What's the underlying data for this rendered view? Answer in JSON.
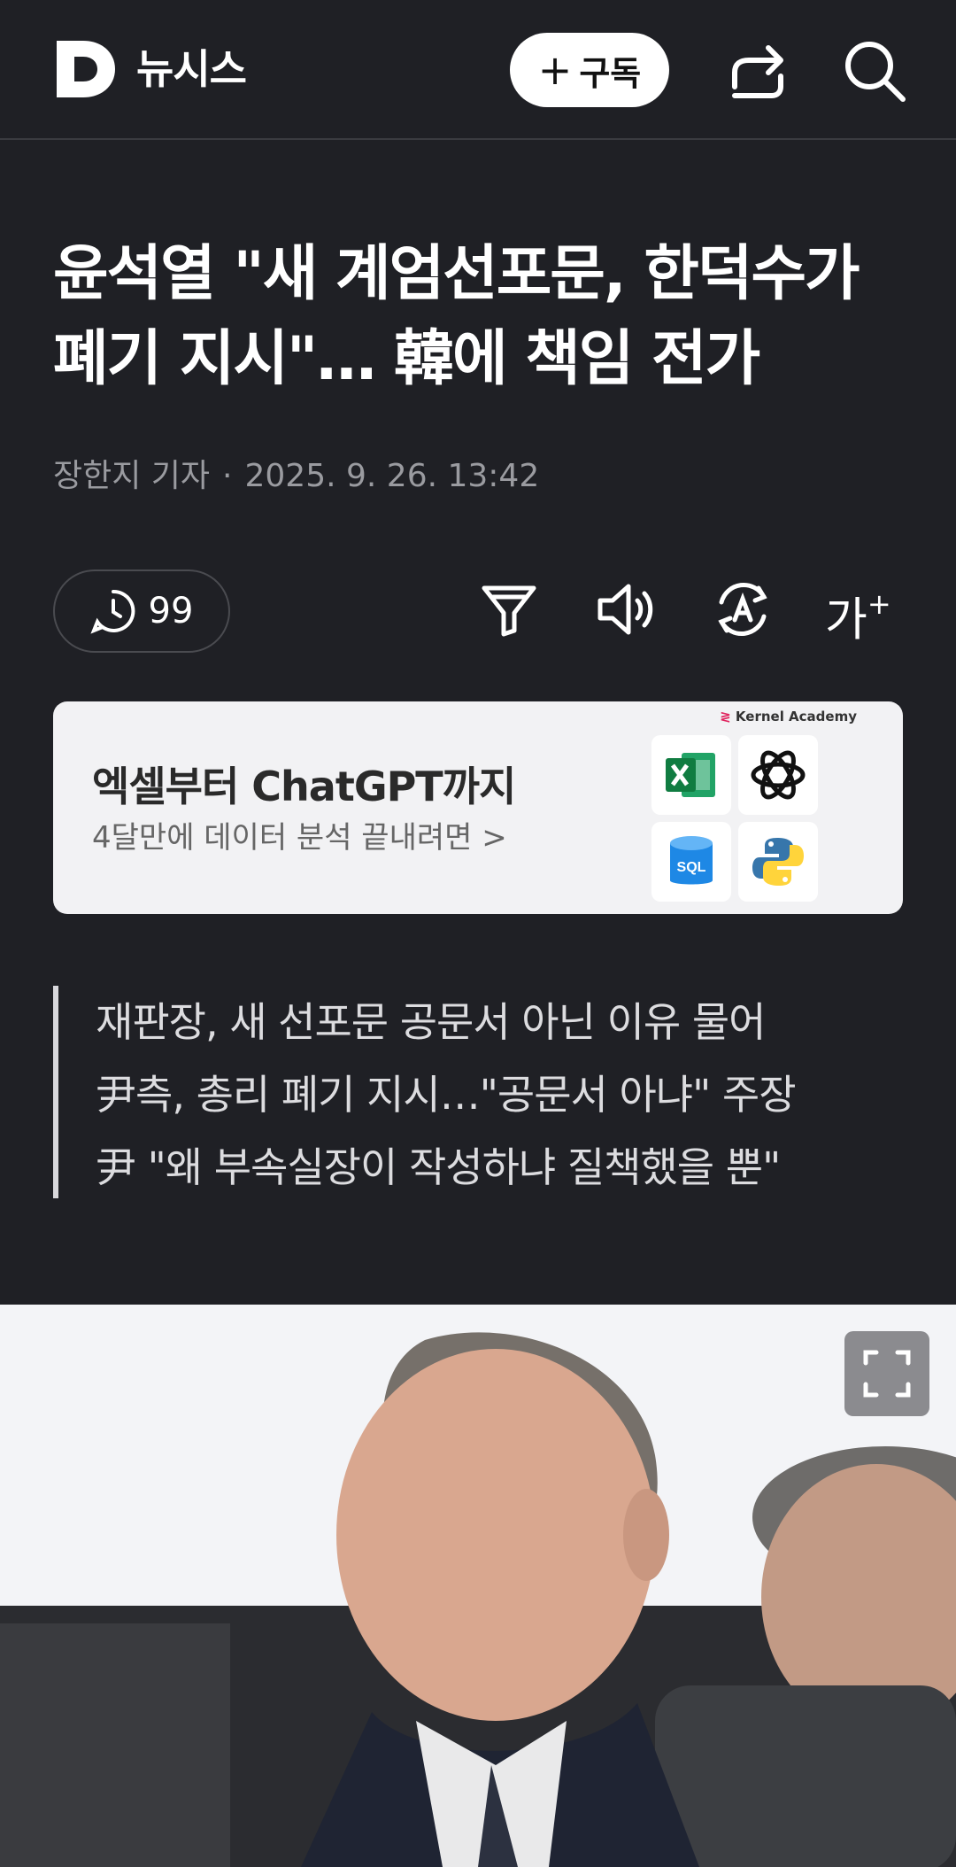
{
  "header": {
    "brand": "뉴시스",
    "subscribe_label": "구독",
    "subscribe_plus": "+"
  },
  "article": {
    "title": "윤석열 \"새 계엄선포문, 한덕수가 폐기 지시\"… 韓에 책임 전가",
    "author": "장한지 기자",
    "separator": "·",
    "date": "2025. 9. 26. 13:42"
  },
  "toolbar": {
    "comment_count": "99",
    "font_size_label": "가",
    "font_size_plus": "+"
  },
  "ad": {
    "brand": "Kernel Academy",
    "title": "엑셀부터 ChatGPT까지",
    "subtitle": "4달만에 데이터 분석 끝내려면 >",
    "tiles": [
      "excel-icon",
      "chatgpt-icon",
      "sql-icon",
      "python-icon"
    ]
  },
  "summary": {
    "lines": [
      "재판장, 새 선포문 공문서 아닌 이유 물어",
      "尹측, 총리 폐기 지시…\"공문서 아냐\" 주장",
      "尹 \"왜 부속실장이 작성하냐 질책했을 뿐\""
    ]
  },
  "colors": {
    "background": "#1f2025",
    "ad_background": "#f2f2f4",
    "meta_text": "#9a9ba0"
  }
}
